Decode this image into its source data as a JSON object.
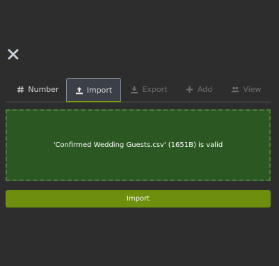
{
  "colors": {
    "background": "#2d2d2d",
    "dropzone_fill": "#2b5722",
    "dropzone_border": "#4d7d3e",
    "accent": "#6e8f0e"
  },
  "close": {
    "icon": "close-icon"
  },
  "tabs": [
    {
      "label": "Number",
      "icon": "hash-icon",
      "state": "normal"
    },
    {
      "label": "Import",
      "icon": "upload-icon",
      "state": "active"
    },
    {
      "label": "Export",
      "icon": "download-icon",
      "state": "disabled"
    },
    {
      "label": "Add",
      "icon": "plus-icon",
      "state": "disabled"
    },
    {
      "label": "View",
      "icon": "users-icon",
      "state": "disabled"
    }
  ],
  "dropzone": {
    "message": "'Confirmed Wedding Guests.csv' (1651B) is valid"
  },
  "import_button": {
    "label": "Import"
  }
}
